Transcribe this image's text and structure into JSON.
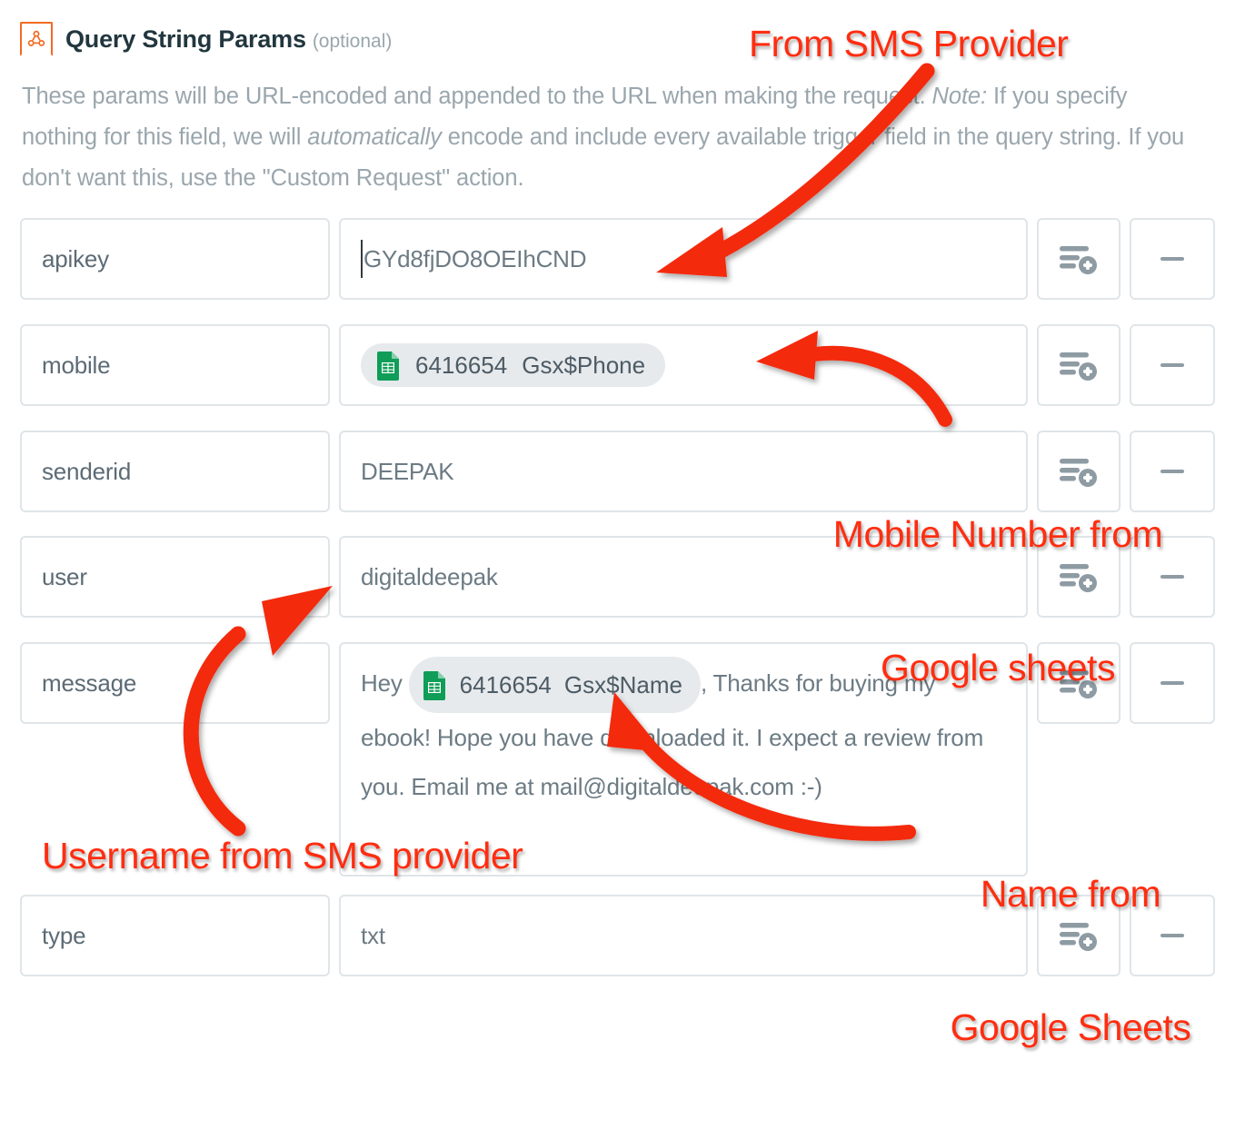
{
  "header": {
    "icon": "webhook-icon",
    "title": "Query String Params",
    "optional_label": "(optional)"
  },
  "description": {
    "part1": "These params will be URL-encoded and appended to the URL when making the request. ",
    "note_italic": "Note:",
    "part2": " If you specify nothing for this field, we will ",
    "auto_italic": "automatically",
    "part3": " encode and include every available trigger field in the query string. If you don't want this, use the \"Custom Request\" action."
  },
  "params": [
    {
      "key": "apikey",
      "value": "GYd8fjDO8OEIhCND",
      "has_caret": true,
      "type": "text"
    },
    {
      "key": "mobile",
      "type": "token",
      "token": {
        "icon": "google-sheets-icon",
        "id": "6416654",
        "field": "Gsx$Phone"
      }
    },
    {
      "key": "senderid",
      "value": "DEEPAK",
      "type": "text"
    },
    {
      "key": "user",
      "value": "digitaldeepak",
      "type": "text"
    },
    {
      "key": "message",
      "type": "rich",
      "prefix": "Hey ",
      "token": {
        "icon": "google-sheets-icon",
        "id": "6416654",
        "field": "Gsx$Name"
      },
      "suffix": ", Thanks for buying my ebook! Hope you have downloaded it. I expect a review from you. Email me at mail@digitaldeepak.com :-)"
    },
    {
      "key": "type",
      "value": "txt",
      "type": "text"
    }
  ],
  "buttons": {
    "insert_field_icon": "insert-field-icon",
    "remove_icon": "minus-icon"
  },
  "annotations": [
    {
      "id": "from-sms-provider",
      "text": "From SMS Provider"
    },
    {
      "id": "mobile-number-from-google-sheets",
      "line1": "Mobile Number from",
      "line2": "Google sheets"
    },
    {
      "id": "username-from-sms-provider",
      "text": "Username from SMS provider"
    },
    {
      "id": "name-from-google-sheets",
      "line1": "Name from",
      "line2": "Google Sheets"
    }
  ],
  "colors": {
    "annotation_red": "#ff2d10",
    "brand_orange": "#f26a22",
    "sheets_green": "#0f9d58",
    "border_grey": "#dfe5e8",
    "text_grey": "#6c7b84"
  }
}
